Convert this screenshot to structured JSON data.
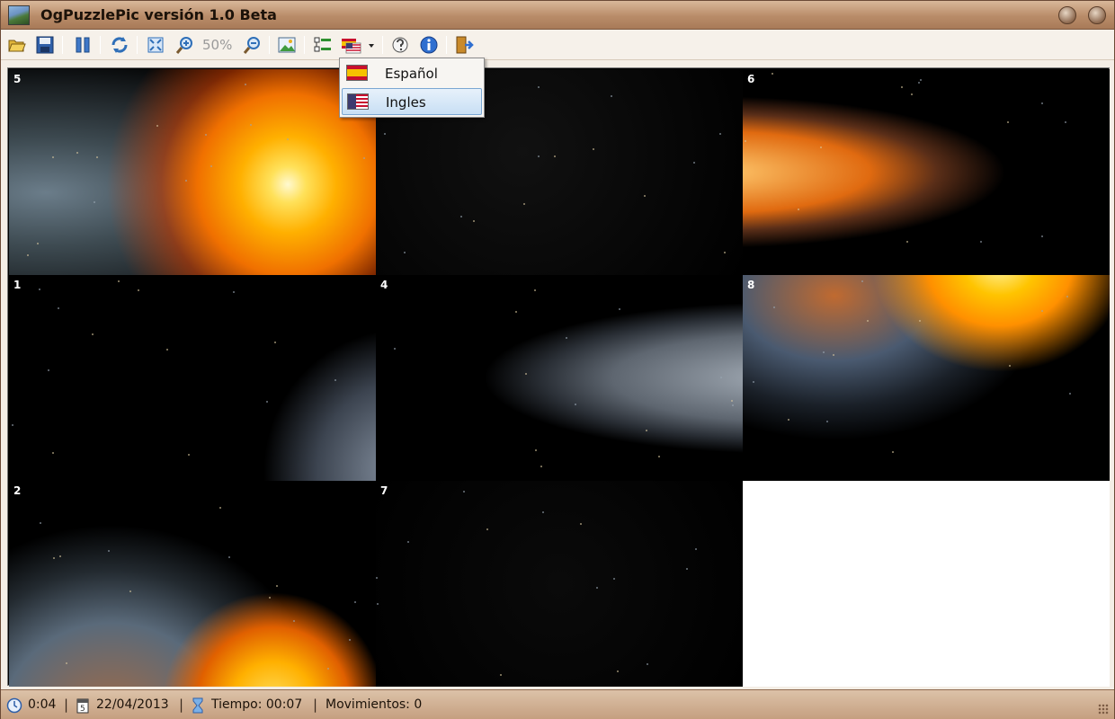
{
  "window": {
    "title": "OgPuzzlePic versión 1.0 Beta"
  },
  "toolbar": {
    "zoom_level": "50%",
    "buttons": [
      {
        "name": "open-folder-icon"
      },
      {
        "name": "save-icon"
      },
      {
        "name": "pause-icon"
      },
      {
        "name": "refresh-icon"
      },
      {
        "name": "fit-screen-icon"
      },
      {
        "name": "zoom-in-icon"
      },
      {
        "name": "zoom-out-icon"
      },
      {
        "name": "image-icon"
      },
      {
        "name": "list-icon"
      },
      {
        "name": "language-flag-icon"
      },
      {
        "name": "help-icon"
      },
      {
        "name": "info-icon"
      },
      {
        "name": "exit-icon"
      }
    ]
  },
  "language_menu": {
    "items": [
      {
        "label": "Español",
        "flag": "spain-flag-icon"
      },
      {
        "label": "Ingles",
        "flag": "usa-flag-icon"
      }
    ]
  },
  "board": {
    "tiles": [
      {
        "number": "5",
        "art": "sun-earth"
      },
      {
        "number": "",
        "art": "stars"
      },
      {
        "number": "6",
        "art": "planet-edge-left"
      },
      {
        "number": "1",
        "art": "stars-planet-corner"
      },
      {
        "number": "4",
        "art": "planet-edge-right"
      },
      {
        "number": "8",
        "art": "earth-sun-top"
      },
      {
        "number": "2",
        "art": "earth-bottom"
      },
      {
        "number": "7",
        "art": "stars"
      },
      {
        "number": "",
        "art": "empty"
      }
    ]
  },
  "status": {
    "clock": "0:04",
    "date": "22/04/2013",
    "time": "Tiempo: 00:07",
    "moves": "Movimientos: 0",
    "separator": "|"
  },
  "colors": {
    "accent": "#b98c69",
    "menu_highlight": "#c8dff4"
  }
}
